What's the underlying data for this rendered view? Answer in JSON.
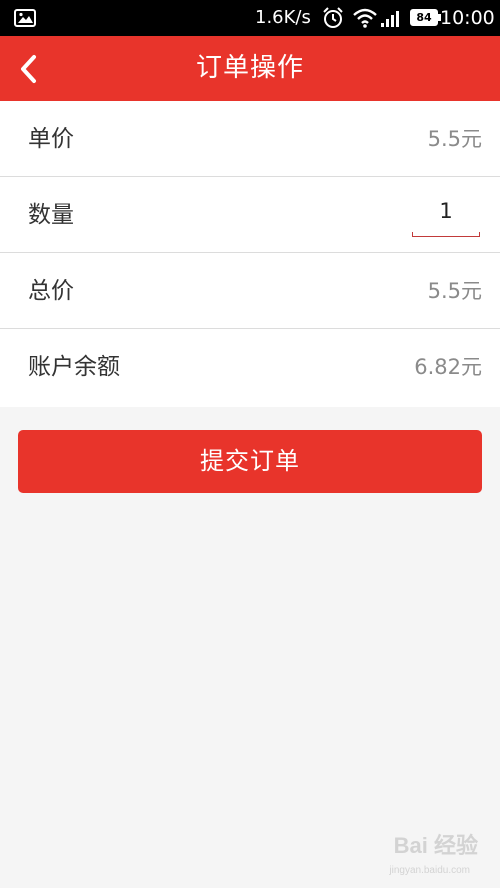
{
  "status_bar": {
    "network_speed": "1.6K/s",
    "battery_level": "84",
    "time": "10:00",
    "icons": [
      "gallery-icon",
      "alarm-icon",
      "wifi-icon",
      "signal-icon",
      "battery-icon"
    ]
  },
  "header": {
    "title": "订单操作",
    "back_icon": "chevron-left-icon"
  },
  "order": {
    "unit_price_label": "单价",
    "unit_price_value": "5.5元",
    "quantity_label": "数量",
    "quantity_value": "1",
    "total_label": "总价",
    "total_value": "5.5元",
    "balance_label": "账户余额",
    "balance_value": "6.82元"
  },
  "actions": {
    "submit_label": "提交订单"
  },
  "watermark": {
    "text": "Bai 经验",
    "sub": "jingyan.baidu.com"
  },
  "colors": {
    "accent": "#e8342b",
    "status_bar": "#000000",
    "background": "#f5f5f5"
  }
}
